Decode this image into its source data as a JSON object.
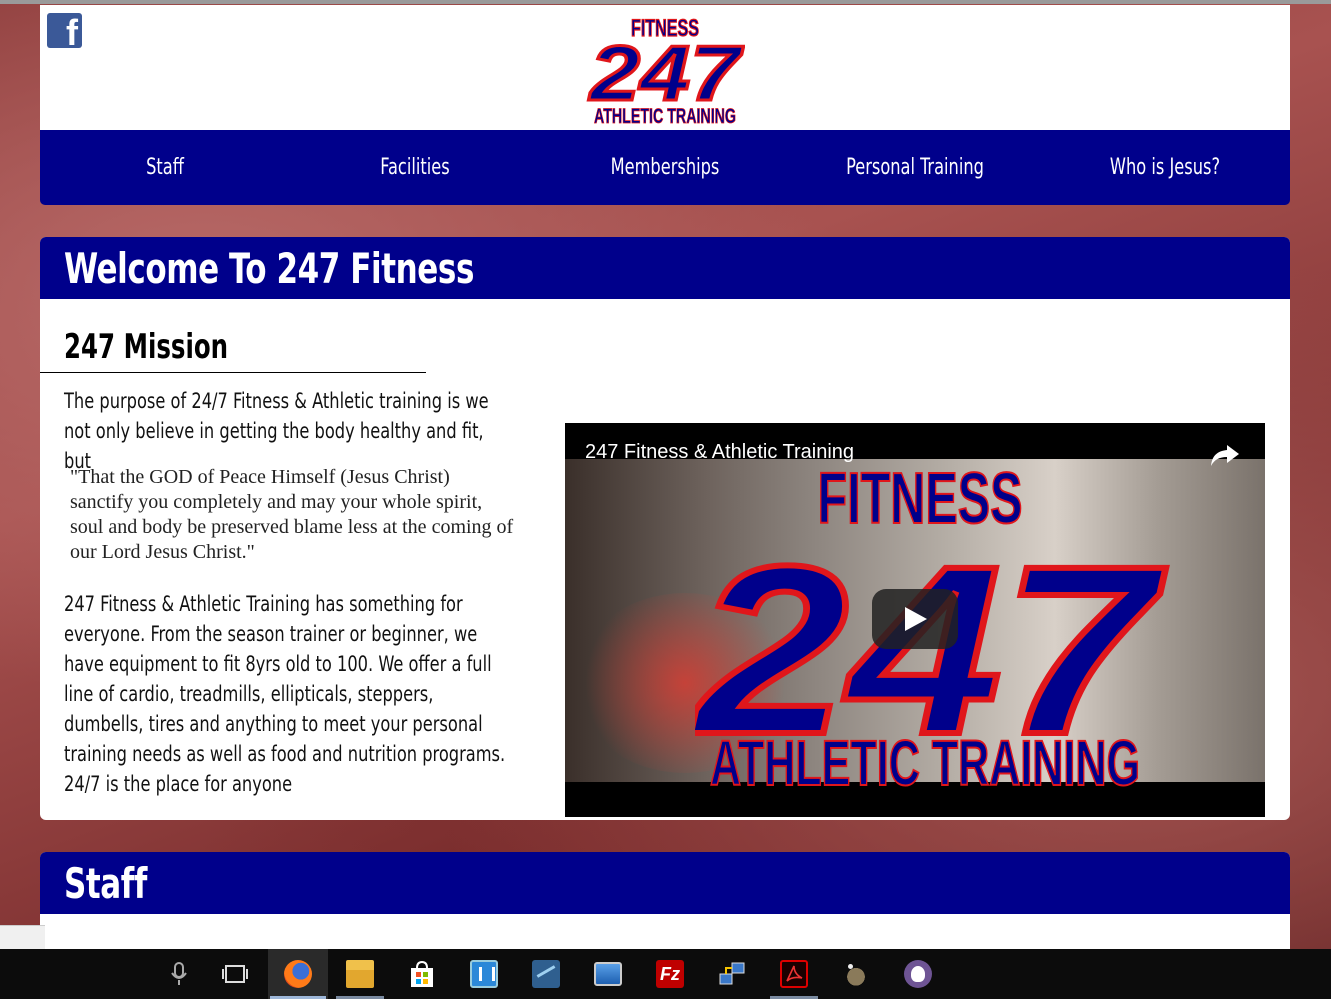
{
  "header": {
    "facebook_glyph": "f",
    "logo": {
      "top": "FITNESS",
      "mid": "247",
      "bottom": "ATHLETIC TRAINING"
    }
  },
  "nav": [
    "Staff",
    "Facilities",
    "Memberships",
    "Personal Training",
    "Who is Jesus?"
  ],
  "welcome": {
    "heading": "Welcome To 247 Fitness",
    "mission_title": "247 Mission",
    "intro": "The purpose of 24/7 Fitness & Athletic training is we not only believe in getting the body healthy and fit, but",
    "quote": "\"That the GOD of Peace Himself (Jesus Christ) sanctify you completely and may your whole spirit, soul and body be preserved blame less at the coming of our Lord Jesus Christ.\"",
    "body": "247 Fitness & Athletic Training has something for everyone. From the season trainer or beginner, we have equipment to fit 8yrs old to 100. We offer a full line of cardio, treadmills, ellipticals, steppers, dumbells, tires and anything to meet your personal training needs as well as food and nutrition programs. 24/7 is the place for anyone"
  },
  "video": {
    "title": "247 Fitness & Athletic Training",
    "logo": {
      "top": "FITNESS",
      "mid": "247",
      "bottom": "ATHLETIC TRAINING"
    }
  },
  "staff": {
    "heading": "Staff"
  },
  "taskbar": {
    "icons": [
      "microphone-icon",
      "task-view-icon",
      "firefox-icon",
      "file-explorer-icon",
      "store-icon",
      "app-icon",
      "mysql-workbench-icon",
      "remote-desktop-icon",
      "filezilla-icon",
      "network-icon",
      "acrobat-icon",
      "gimp-icon",
      "github-icon"
    ]
  },
  "colors": {
    "nav_blue": "#00008b",
    "logo_red": "#e0161b"
  }
}
